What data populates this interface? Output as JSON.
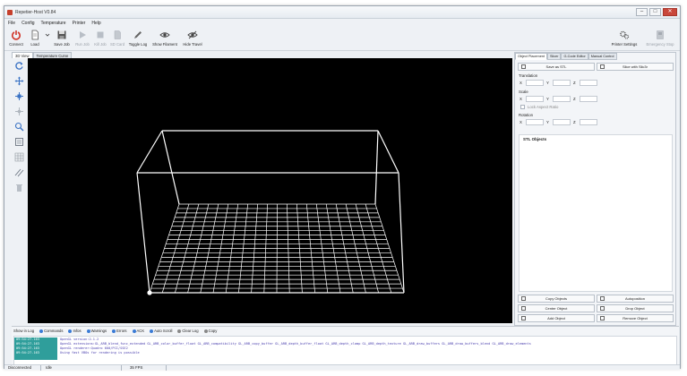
{
  "window": {
    "title": "Repetier-Host V0.84",
    "minimize": "–",
    "maximize": "□",
    "close": "✕"
  },
  "menu": [
    "File",
    "Config",
    "Temperature",
    "Printer",
    "Help"
  ],
  "toolbar": {
    "connect": "Connect",
    "load": "Load",
    "save_job": "Save Job",
    "run_job": "Run Job",
    "kill_job": "Kill Job",
    "sd_card": "SD Card",
    "toggle_log": "Toggle Log",
    "show_filament": "Show Filament",
    "hide_travel": "Hide Travel",
    "printer_settings": "Printer Settings",
    "emergency_stop": "Emergency Stop"
  },
  "view_tabs": [
    "3D View",
    "Temperature Curve"
  ],
  "right_tabs": [
    "Object Placement",
    "Slicer",
    "G-Code Editor",
    "Manual Control"
  ],
  "placement": {
    "save_stl": "Save as STL",
    "slice": "Slice with Slic3r",
    "translation": "Translation",
    "scale": "Scale",
    "lock_aspect": "Lock Aspect Ratio",
    "rotation": "Rotation",
    "x": "X",
    "y": "Y",
    "z": "Z",
    "stl_objects": "STL Objects",
    "copy_objects": "Copy Objects",
    "autoposition": "Autoposition",
    "center_object": "Center Object",
    "drop_object": "Drop Object",
    "add_object": "Add Object",
    "remove_object": "Remove Object"
  },
  "log_toolbar": [
    "Show in Log",
    "Commands",
    "Infos",
    "Warnings",
    "Errors",
    "ACK",
    "Auto Scroll",
    "Clear Log",
    "Copy"
  ],
  "log_rows": [
    {
      "time": "09:54:27.163",
      "msg": "OpenGL version:2.1.2"
    },
    {
      "time": "09:54:27.163",
      "msg": "OpenGL extensions:GL_ARB_blend_func_extended GL_ARB_color_buffer_float GL_ARB_compatibility GL_ARB_copy_buffer GL_ARB_depth_buffer_float GL_ARB_depth_clamp GL_ARB_depth_texture GL_ARB_draw_buffers GL_ARB_draw_buffers_blend GL_ARB_draw_elements"
    },
    {
      "time": "09:54:27.163",
      "msg": "OpenGL renderer:Quadro 600/PCI/SSE2"
    },
    {
      "time": "09:54:27.163",
      "msg": "Using fast VBOs for rendering is possible"
    }
  ],
  "status": {
    "connection": "Disconnected",
    "state": "Idle",
    "fps": "35 FPS"
  },
  "colors": {
    "viewport_bg": "#000000",
    "grid": "#ffffff",
    "log_time_bg": "#2f9e9b",
    "log_text": "#4a3fae",
    "connect_icon": "#d1362a"
  }
}
